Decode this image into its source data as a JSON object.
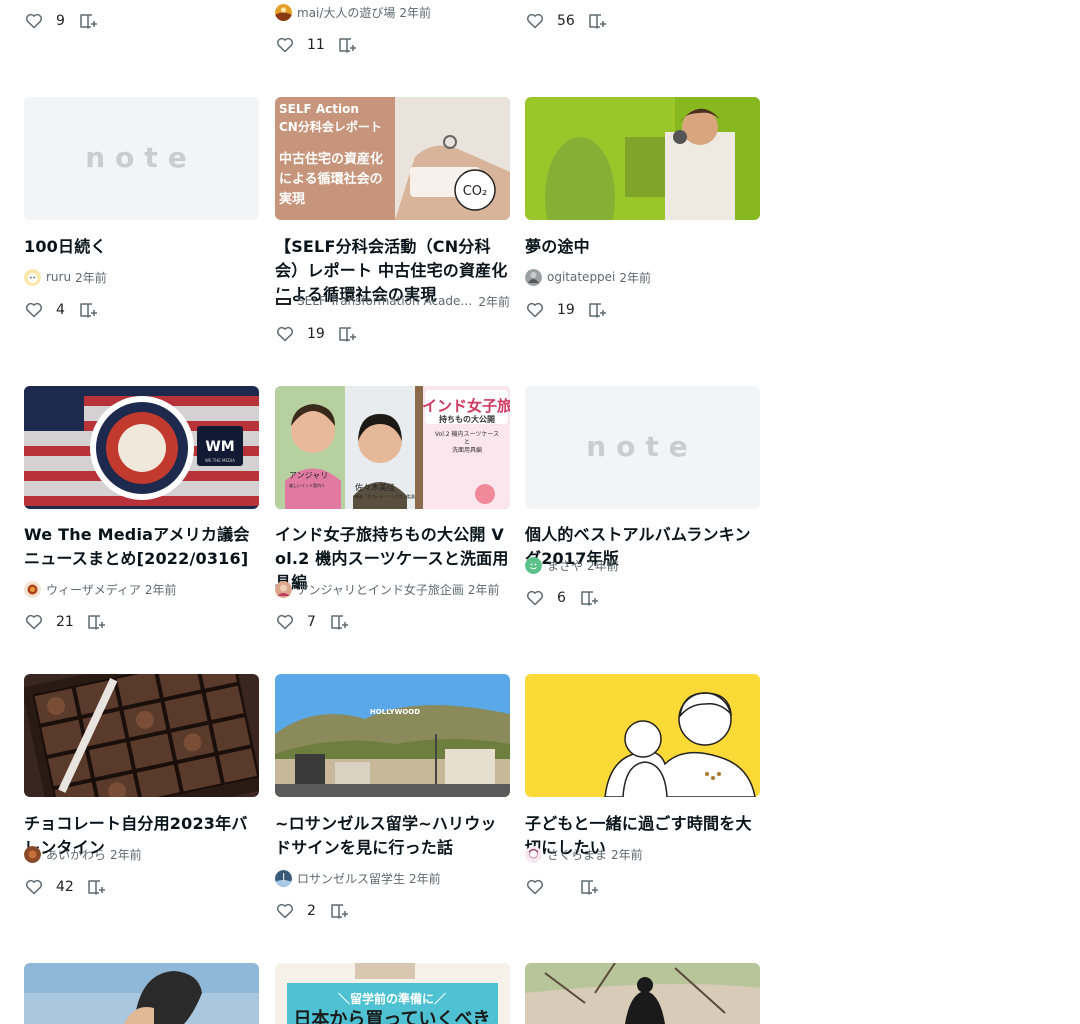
{
  "icons": {
    "like": "heart-outline-icon",
    "save": "bookmark-add-icon"
  },
  "colors": {
    "text": "#08131a",
    "meta": "#5e6a70",
    "placeholder": "#f2f4f5",
    "note_logo": "#c9cdd0"
  },
  "cards": [
    {
      "likes": "9"
    },
    {
      "author": "mai/大人の遊び場",
      "time": "2年前",
      "likes": "11"
    },
    {
      "likes": "56"
    },
    {
      "thumb_note_logo": "note",
      "title": "100日続く",
      "author": "ruru",
      "time": "2年前",
      "likes": "4"
    },
    {
      "thumb_text": [
        "SELF Action",
        "CN分科会レポート",
        "中古住宅の資産化",
        "による循環社会の",
        "実現"
      ],
      "thumb_badge": "CO₂",
      "title": "【SELF分科会活動（CN分科会）レポート 中古住宅の資産化による循環社会の実現",
      "author": "SELF Transformation Academy",
      "time": "2年前",
      "likes": "19"
    },
    {
      "title": "夢の途中",
      "author": "ogitateppei",
      "time": "2年前",
      "likes": "19"
    },
    {
      "thumb_logo": "WM",
      "thumb_logo_sub": "WE THE MEDIA",
      "title": "We The Mediaアメリカ議会ニュースまとめ[2022/0316]",
      "author": "ウィーザメディア",
      "time": "2年前",
      "likes": "21"
    },
    {
      "thumb_title": "インド女子旅",
      "thumb_sub": "持ちもの大公開",
      "thumb_vol": "Vol.2 機内スーツケース",
      "thumb_vol2": "と",
      "thumb_vol3": "洗面用具編",
      "thumb_p1": "アンジャリ",
      "thumb_p1_sub": "楽しいインド案内人",
      "thumb_p2": "佐々木美佳",
      "thumb_p2_sub": "映画「タゴール・ソングス」監督",
      "title": "インド女子旅持ちもの大公開 Vol.2 機内スーツケースと洗面用具編",
      "author": "アンジャリとインド女子旅企画",
      "time": "2年前",
      "likes": "7"
    },
    {
      "thumb_note_logo": "note",
      "title": "個人的ベストアルバムランキング2017年版",
      "author": "まさや",
      "time": "2年前",
      "likes": "6"
    },
    {
      "title": "チョコレート自分用2023年バレンタイン",
      "author": "あいかわら",
      "time": "2年前",
      "likes": "42"
    },
    {
      "thumb_sign": "HOLLYWOOD",
      "title": "~ロサンゼルス留学~ハリウッドサインを見に行った話",
      "author": "ロサンゼルス留学生",
      "time": "2年前",
      "likes": "2"
    },
    {
      "title": "子どもと一緒に過ごす時間を大切にしたい",
      "author": "さくらまま",
      "time": "2年前",
      "likes": ""
    },
    {},
    {
      "thumb_text": [
        "＼留学前の準備に／",
        "日本から買っていくべき"
      ]
    },
    {}
  ]
}
